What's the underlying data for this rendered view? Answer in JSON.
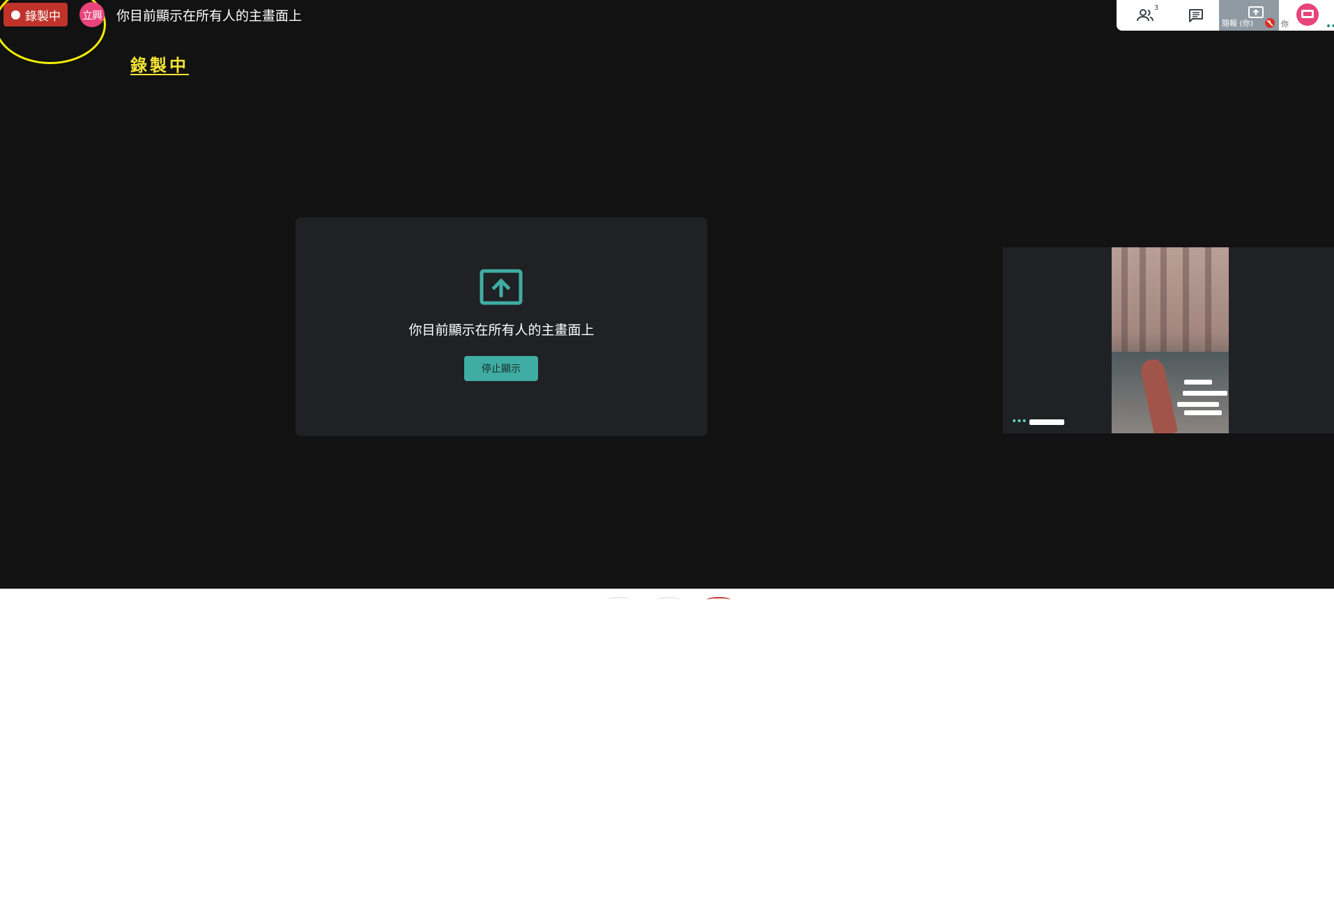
{
  "recording": {
    "label": "錄製中"
  },
  "presenter": {
    "avatar_text": "立興"
  },
  "header": {
    "title": "你目前顯示在所有人的主畫面上"
  },
  "annotation": {
    "text": "錄製中"
  },
  "controls": {
    "people_count": "3",
    "present_tile_label": "簡報 (你)",
    "self_label": "你"
  },
  "presenting_card": {
    "message": "你目前顯示在所有人的主畫面上",
    "stop_button": "停止顯示"
  },
  "colors": {
    "stage_bg": "#121212",
    "card_bg": "#202124",
    "accent_teal": "#3fada3",
    "recording_red": "#c0332b",
    "avatar_pink": "#e8437a",
    "annotation_yellow": "#f5e431"
  }
}
